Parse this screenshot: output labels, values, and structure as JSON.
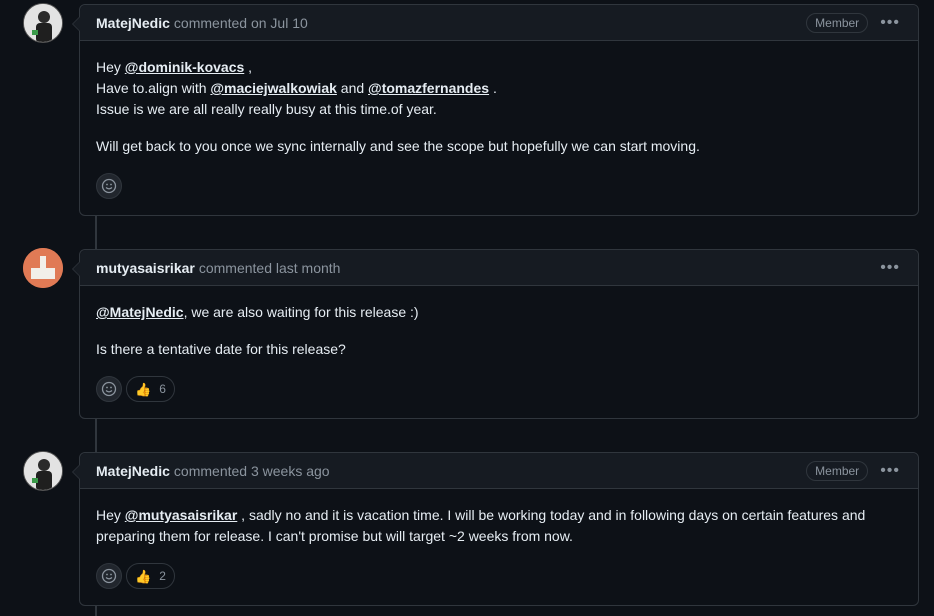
{
  "comments": [
    {
      "author": "MatejNedic",
      "meta": "commented on Jul 10",
      "badge": "Member",
      "body": {
        "l1_pre": "Hey ",
        "l1_mention": "@dominik-kovacs",
        "l1_post": " ,",
        "l2_pre": "Have to.align with ",
        "l2_mention1": "@maciejwalkowiak",
        "l2_mid": " and ",
        "l2_mention2": "@tomazfernandes",
        "l2_post": " .",
        "l3": "Issue is we are all really really busy at this time.of year.",
        "p2": "Will get back to you once we sync internally and see the scope but hopefully we can start moving."
      }
    },
    {
      "author": "mutyasaisrikar",
      "meta": "commented last month",
      "body": {
        "p1_mention": "@MatejNedic",
        "p1_post": ", we are also waiting for this release :)",
        "p2": "Is there a tentative date for this release?"
      },
      "reaction": {
        "emoji": "👍",
        "count": "6"
      }
    },
    {
      "author": "MatejNedic",
      "meta": "commented 3 weeks ago",
      "badge": "Member",
      "body": {
        "p1_pre": "Hey ",
        "p1_mention": "@mutyasaisrikar",
        "p1_post": " , sadly no and it is vacation time. I will be working today and in following days on certain features and preparing them for release. I can't promise but will target ~2 weeks from now."
      },
      "reaction": {
        "emoji": "👍",
        "count": "2"
      }
    }
  ],
  "icons": {
    "more": "kebab-horizontal-icon",
    "add_reaction": "smiley-icon"
  },
  "colors": {
    "background": "#0d1117",
    "header": "#161b22",
    "border": "#30363d",
    "muted": "#8b949e"
  }
}
